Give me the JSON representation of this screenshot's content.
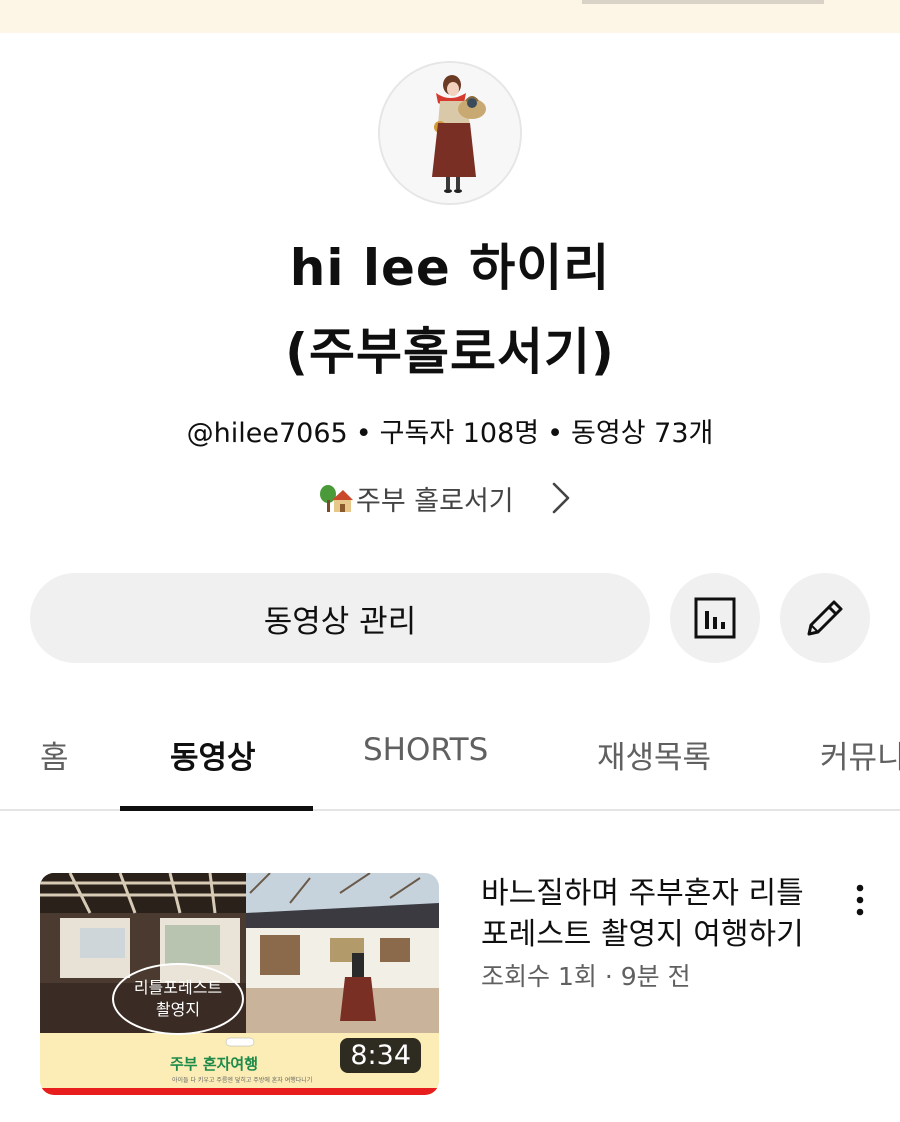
{
  "channel": {
    "name_line1": "hi lee  하이리",
    "name_line2": "(주부홀로서기)",
    "handle": "@hilee7065",
    "subscribers": "구독자 108명",
    "videos_count": "동영상 73개",
    "separator": "•",
    "description": "주부 홀로서기"
  },
  "actions": {
    "manage_videos_label": "동영상 관리"
  },
  "tabs": [
    {
      "label": "홈"
    },
    {
      "label": "동영상"
    },
    {
      "label": "SHORTS"
    },
    {
      "label": "재생목록"
    },
    {
      "label": "커뮤니"
    }
  ],
  "active_tab": "동영상",
  "videos": [
    {
      "title": "바느질하며 주부혼자 리틀포레스트 촬영지 여행하기",
      "views": "조회수 1회",
      "age": "9분 전",
      "meta_sep": "·",
      "duration": "8:34",
      "thumb_oval_line1": "리틀포레스트",
      "thumb_oval_line2": "촬영지",
      "thumb_caption": "주부 혼자여행",
      "thumb_subcaption": "아이들 다 키우고 주름엔 덮히고 주방에 혼자 여행다니기",
      "watch_progress": 1.0
    }
  ],
  "colors": {
    "banner": "#fdf5e6",
    "button_bg": "#f0f0f0",
    "progress": "#e81e1e",
    "caption_green": "#1d8a4a"
  },
  "icons": [
    "house-tree-emoji",
    "chevron-right-icon",
    "analytics-icon",
    "pencil-icon",
    "more-vert-icon"
  ]
}
